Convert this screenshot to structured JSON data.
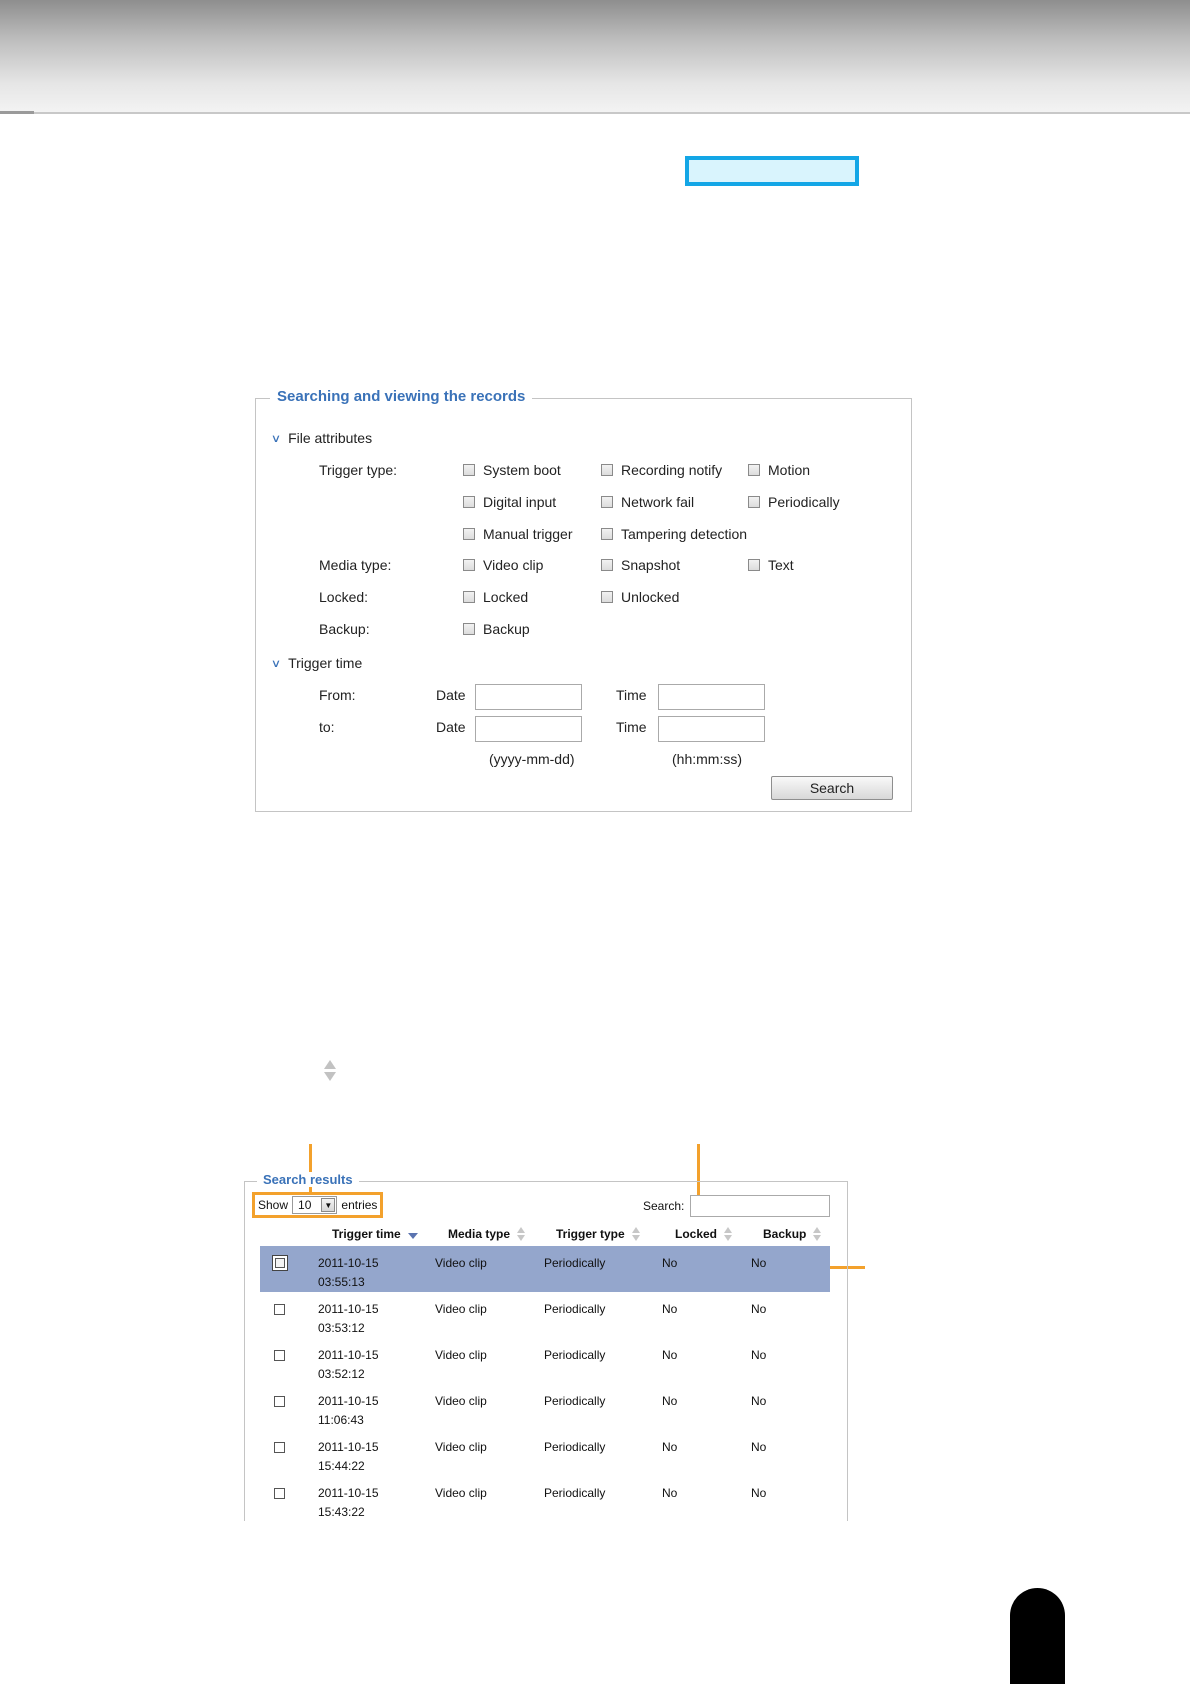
{
  "search_panel": {
    "title": "Searching and viewing the records",
    "file_attributes_label": "File attributes",
    "trigger_type_label": "Trigger type:",
    "trigger_types": [
      "System boot",
      "Recording notify",
      "Motion",
      "Digital input",
      "Network fail",
      "Periodically",
      "Manual trigger",
      "Tampering detection"
    ],
    "media_type_label": "Media type:",
    "media_types": [
      "Video clip",
      "Snapshot",
      "Text"
    ],
    "locked_label": "Locked:",
    "locked_options": [
      "Locked",
      "Unlocked"
    ],
    "backup_label": "Backup:",
    "backup_options": [
      "Backup"
    ],
    "trigger_time_label": "Trigger time",
    "from_label": "From:",
    "to_label": "to:",
    "date_label": "Date",
    "time_label": "Time",
    "date_hint": "(yyyy-mm-dd)",
    "time_hint": "(hh:mm:ss)",
    "search_button": "Search"
  },
  "results_panel": {
    "title": "Search results",
    "show_label": "Show",
    "show_value": "10",
    "entries_label": "entries",
    "search_label": "Search:",
    "columns": [
      "Trigger time",
      "Media type",
      "Trigger type",
      "Locked",
      "Backup"
    ],
    "rows": [
      {
        "date": "2011-10-15",
        "time": "03:55:13",
        "media": "Video clip",
        "trigger": "Periodically",
        "locked": "No",
        "backup": "No"
      },
      {
        "date": "2011-10-15",
        "time": "03:53:12",
        "media": "Video clip",
        "trigger": "Periodically",
        "locked": "No",
        "backup": "No"
      },
      {
        "date": "2011-10-15",
        "time": "03:52:12",
        "media": "Video clip",
        "trigger": "Periodically",
        "locked": "No",
        "backup": "No"
      },
      {
        "date": "2011-10-15",
        "time": "11:06:43",
        "media": "Video clip",
        "trigger": "Periodically",
        "locked": "No",
        "backup": "No"
      },
      {
        "date": "2011-10-15",
        "time": "15:44:22",
        "media": "Video clip",
        "trigger": "Periodically",
        "locked": "No",
        "backup": "No"
      },
      {
        "date": "2011-10-15",
        "time": "15:43:22",
        "media": "Video clip",
        "trigger": "Periodically",
        "locked": "No",
        "backup": "No"
      }
    ]
  },
  "colors": {
    "highlight_border": "#13a6e6",
    "callout": "#f3a12c",
    "legend_text": "#3a72b8",
    "selected_row": "#94a6cc"
  }
}
